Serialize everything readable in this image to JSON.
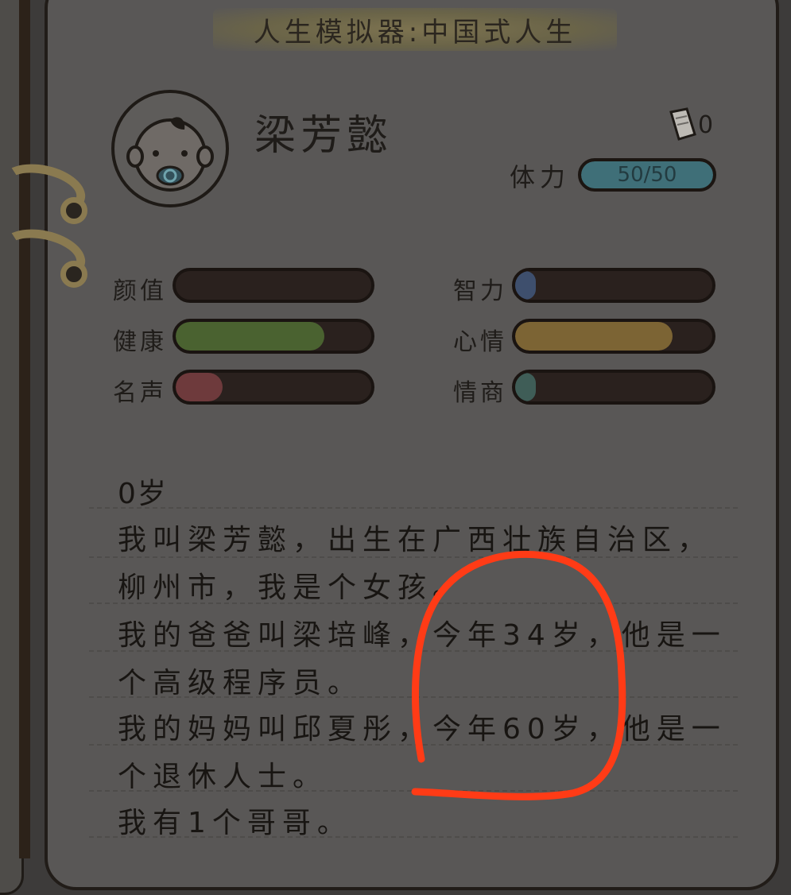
{
  "title": "人生模拟器:中国式人生",
  "profile": {
    "name": "梁芳懿",
    "ticket_count": "0",
    "stamina_label": "体力",
    "stamina_value": "50/50",
    "stamina_level": 1.0
  },
  "stats": [
    {
      "label": "颜值",
      "level": 0.0,
      "color": "#4a3a36"
    },
    {
      "label": "智力",
      "level": 0.06,
      "color": "#3e4f6d"
    },
    {
      "label": "健康",
      "level": 0.76,
      "color": "#4a6230"
    },
    {
      "label": "心情",
      "level": 0.8,
      "color": "#7c6434"
    },
    {
      "label": "名声",
      "level": 0.24,
      "color": "#6e3a3c"
    },
    {
      "label": "情商",
      "level": 0.07,
      "color": "#3f5d57"
    }
  ],
  "story": {
    "age": "0岁",
    "lines": [
      "我叫梁芳懿，出生在广西壮族自治区，",
      "柳州市，我是个女孩。",
      "我的爸爸叫梁培峰，今年34岁，他是一",
      "个高级程序员。",
      "我的妈妈叫邱夏彤，今年60岁，他是一",
      "个退休人士。",
      "我有1个哥哥。"
    ]
  },
  "annotation_color": "#ff3b16",
  "icons": {
    "avatar": "baby-avatar-icon",
    "ticket": "ticket-icon"
  }
}
